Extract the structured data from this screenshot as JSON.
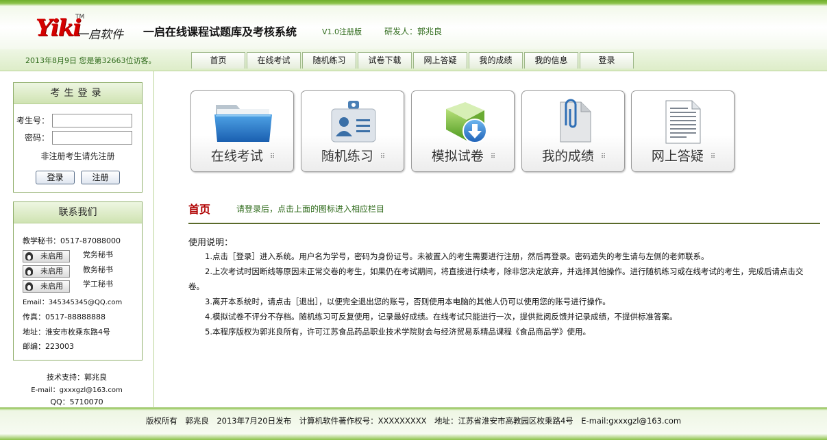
{
  "header": {
    "logo_main": "Yiki",
    "logo_cn": "一启软件",
    "logo_tm": "TM",
    "system_title": "一启在线课程试题库及考核系统",
    "version": "V1.0注册版",
    "developer": "研发人：郭兆良"
  },
  "navbar": {
    "visit_text": "2013年8月9日 您是第32663位访客。",
    "items": [
      "首页",
      "在线考试",
      "随机练习",
      "试卷下载",
      "网上答疑",
      "我的成绩",
      "我的信息",
      "登录"
    ]
  },
  "login": {
    "title": "考生登录",
    "student_id_label": "考生号：",
    "password_label": "密码：",
    "register_hint": "非注册考生请先注册",
    "login_button": "登录",
    "register_button": "注册"
  },
  "contact": {
    "title": "联系我们",
    "teaching_secretary": "教学秘书：0517-87088000",
    "qq_buttons": [
      {
        "label": "未启用",
        "role": "党务秘书"
      },
      {
        "label": "未启用",
        "role": "教务秘书"
      },
      {
        "label": "未启用",
        "role": "学工秘书"
      }
    ],
    "email": "Email：345345345@QQ.com",
    "fax": "传真：0517-88888888",
    "address": "地址：淮安市枚乘东路4号",
    "postcode": "邮编：223003"
  },
  "support": {
    "tech": "技术支持：郭兆良",
    "email": "E-mail：gxxxgzl@163.com",
    "qq": "QQ：5710070"
  },
  "tiles": [
    {
      "label": "在线考试",
      "icon": "folder-icon"
    },
    {
      "label": "随机练习",
      "icon": "id-card-icon"
    },
    {
      "label": "模拟试卷",
      "icon": "download-icon"
    },
    {
      "label": "我的成绩",
      "icon": "paperclip-document-icon"
    },
    {
      "label": "网上答疑",
      "icon": "text-document-icon"
    }
  ],
  "main": {
    "home_title": "首页",
    "home_hint": "请登录后，点击上面的图标进入相应栏目",
    "usage_title": "使用说明：",
    "usage_items": [
      "1.点击［登录］进入系统。用户名为学号，密码为身份证号。未被置入的考生需要进行注册，然后再登录。密码遗失的考生请与左侧的老师联系。",
      "2.上次考试时因断线等原因未正常交卷的考生，如果仍在考试期间，将直接进行续考，除非您决定放弃，并选择其他操作。进行随机练习或在线考试的考生，完成后请点击交卷。",
      "3.离开本系统时，请点击［退出］，以便完全退出您的账号，否则使用本电脑的其他人仍可以使用您的账号进行操作。",
      "4.模拟试卷不评分不存档。随机练习可反复使用，记录最好成绩。在线考试只能进行一次，提供批阅反馈并记录成绩，不提供标准答案。",
      "5.本程序版权为郭兆良所有，许可江苏食品药品职业技术学院财会与经济贸易系精品课程《食品商品学》使用。"
    ]
  },
  "footer": {
    "text": "版权所有　郭兆良　2013年7月20日发布　计算机软件著作权号：XXXXXXXXX　地址：江苏省淮安市高教园区枚乘路4号　E-mail:gxxxgzl@163.com"
  },
  "colors": {
    "accent_green": "#8cc24a",
    "text_green": "#2e6a1a",
    "home_red": "#b00000"
  }
}
